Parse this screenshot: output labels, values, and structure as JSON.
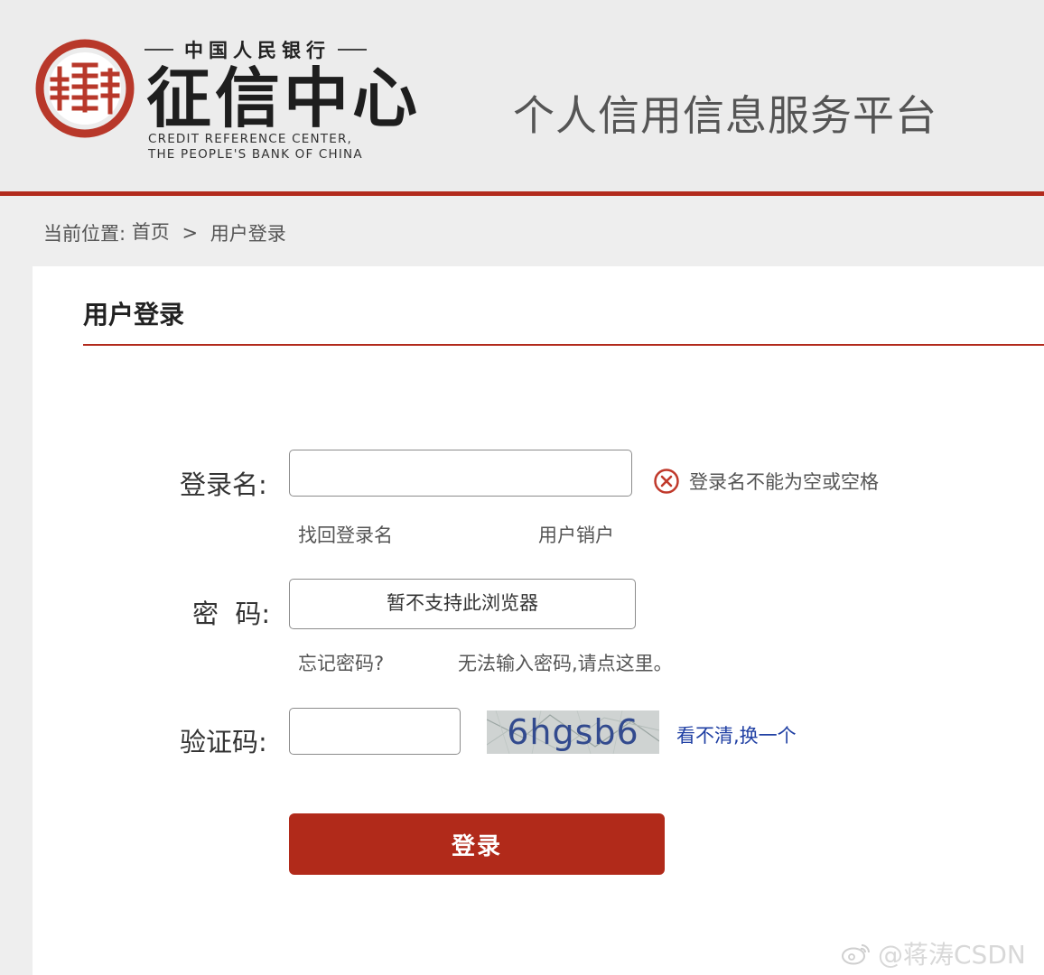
{
  "header": {
    "logo_top": "中国人民银行",
    "logo_main": "征信中心",
    "logo_en_line1": "CREDIT REFERENCE CENTER,",
    "logo_en_line2": "THE PEOPLE'S BANK OF CHINA",
    "platform_title": "个人信用信息服务平台"
  },
  "breadcrumb": {
    "label": "当前位置:",
    "home": "首页",
    "separator": ">",
    "current": "用户登录"
  },
  "login": {
    "title": "用户登录",
    "username_label": "登录名:",
    "username_value": "",
    "username_error": "登录名不能为空或空格",
    "find_username_link": "找回登录名",
    "cancel_account_link": "用户销户",
    "password_label": "密  码:",
    "password_notice": "暂不支持此浏览器",
    "forgot_password_link": "忘记密码?",
    "cannot_input_link": "无法输入密码,请点这里。",
    "captcha_label": "验证码:",
    "captcha_value": "",
    "captcha_text": "6hgsb6",
    "refresh_captcha_link": "看不清,换一个",
    "submit_label": "登录"
  },
  "watermark": {
    "text": "@蒋涛CSDN"
  },
  "colors": {
    "brand_red": "#b22a1c",
    "link_blue": "#1f3fa3",
    "page_bg": "#eeeeee"
  }
}
